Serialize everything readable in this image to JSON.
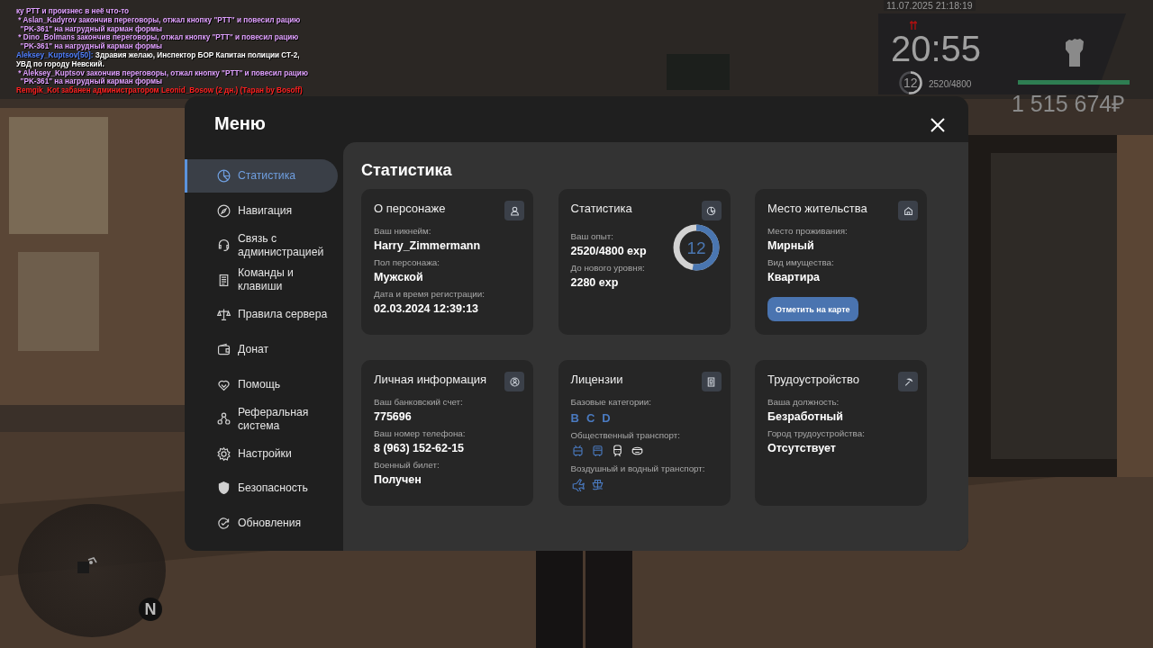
{
  "chat": [
    {
      "parts": [
        {
          "text": "ку РТТ и произнес в неё что-то",
          "color": "#e0a0ff"
        }
      ]
    },
    {
      "parts": [
        {
          "text": " * Aslan_Kadyrov закончив переговоры, отжал кнопку \"PTT\" и повесил рацию",
          "color": "#e0a0ff"
        }
      ]
    },
    {
      "parts": [
        {
          "text": "  \"PK-361\" на нагрудный карман формы",
          "color": "#e0a0ff"
        }
      ]
    },
    {
      "parts": [
        {
          "text": " * Dino_Bolmans закончив переговоры, отжал кнопку \"PTT\" и повесил рацию",
          "color": "#e0a0ff"
        }
      ]
    },
    {
      "parts": [
        {
          "text": "  \"PK-361\" на нагрудный карман формы",
          "color": "#e0a0ff"
        }
      ]
    },
    {
      "parts": [
        {
          "text": "Aleksey_Kuptsov[50]:",
          "color": "#4f7fff"
        },
        {
          "text": " Здравия желаю, Инспектор БОР Капитан полиции СТ-2,",
          "color": "#ffffff"
        }
      ]
    },
    {
      "parts": [
        {
          "text": "УВД по городу Невский.",
          "color": "#ffffff"
        }
      ]
    },
    {
      "parts": [
        {
          "text": " * Aleksey_Kuptsov закончив переговоры, отжал кнопку \"PTT\" и повесил рацию",
          "color": "#e0a0ff"
        }
      ]
    },
    {
      "parts": [
        {
          "text": "  \"PK-361\" на нагрудный карман формы",
          "color": "#e0a0ff"
        }
      ]
    },
    {
      "parts": [
        {
          "text": "Remgik_Kot забанен администратором Leonid_Bosow (2 дн.) (Таран by Bosoff)",
          "color": "#ff2020"
        }
      ]
    }
  ],
  "hud": {
    "datetime": "11.07.2025 21:18:19",
    "time": "20:55",
    "level": "12",
    "xp": "2520/4800",
    "xp_ring": {
      "level": 0.525
    },
    "health": {
      "level": 1
    },
    "money": "1 515 674₽"
  },
  "minimap": {
    "north": "N"
  },
  "menu": {
    "title": "Меню",
    "sidebar": [
      {
        "label": "Статистика",
        "selected": true
      },
      {
        "label": "Навигация",
        "selected": false
      },
      {
        "label": "Связь с администрацией",
        "selected": false
      },
      {
        "label": "Команды и клавиши",
        "selected": false
      },
      {
        "label": "Правила сервера",
        "selected": false
      },
      {
        "label": "Донат",
        "selected": false
      },
      {
        "label": "Помощь",
        "selected": false
      },
      {
        "label": "Реферальная система",
        "selected": false
      },
      {
        "label": "Настройки",
        "selected": false
      },
      {
        "label": "Безопасность",
        "selected": false
      },
      {
        "label": "Обновления",
        "selected": false
      }
    ],
    "page_title": "Статистика",
    "cards": [
      {
        "kind": "fields",
        "title": "О персонаже",
        "fields": [
          {
            "label": "Ваш никнейм:",
            "value": "Harry_Zimmermann"
          },
          {
            "label": "Пол персонажа:",
            "value": "Мужской"
          },
          {
            "label": "Дата и время регистрации:",
            "value": "02.03.2024 12:39:13"
          }
        ]
      },
      {
        "kind": "level",
        "title": "Статистика",
        "fields": [
          {
            "label": "Ваш опыт:",
            "value": "2520/4800 exp"
          },
          {
            "label": "До нового уровня:",
            "value": "2280 exp"
          }
        ],
        "ring": {
          "value": "12",
          "level": 0.525
        }
      },
      {
        "kind": "fields",
        "title": "Место жительства",
        "fields": [
          {
            "label": "Место проживания:",
            "value": "Мирный"
          },
          {
            "label": "Вид имущества:",
            "value": "Квартира"
          }
        ],
        "button": "Отметить на карте"
      },
      {
        "kind": "fields",
        "title": "Личная информация",
        "fields": [
          {
            "label": "Ваш банковский счет:",
            "value": "775696"
          },
          {
            "label": "Ваш номер телефона:",
            "value": "8 (963) 152-62-15"
          },
          {
            "label": "Военный билет:",
            "value": "Получен"
          }
        ]
      },
      {
        "kind": "licenses",
        "title": "Лицензии",
        "categories_label": "Базовые категории:",
        "categories": [
          "B",
          "C",
          "D"
        ],
        "groups": [
          {
            "label": "Общественный транспорт:",
            "items": [
              {
                "owned": true
              },
              {
                "owned": true
              },
              {
                "owned": false
              },
              {
                "owned": false
              }
            ]
          },
          {
            "label": "Воздушный и водный транспорт:",
            "items": [
              {
                "owned": true
              },
              {
                "owned": true
              }
            ]
          }
        ]
      },
      {
        "kind": "fields",
        "title": "Трудоустройство",
        "fields": [
          {
            "label": "Ваша должность:",
            "value": "Безработный"
          },
          {
            "label": "Город трудоустройства:",
            "value": "Отсутствует"
          }
        ]
      }
    ]
  }
}
